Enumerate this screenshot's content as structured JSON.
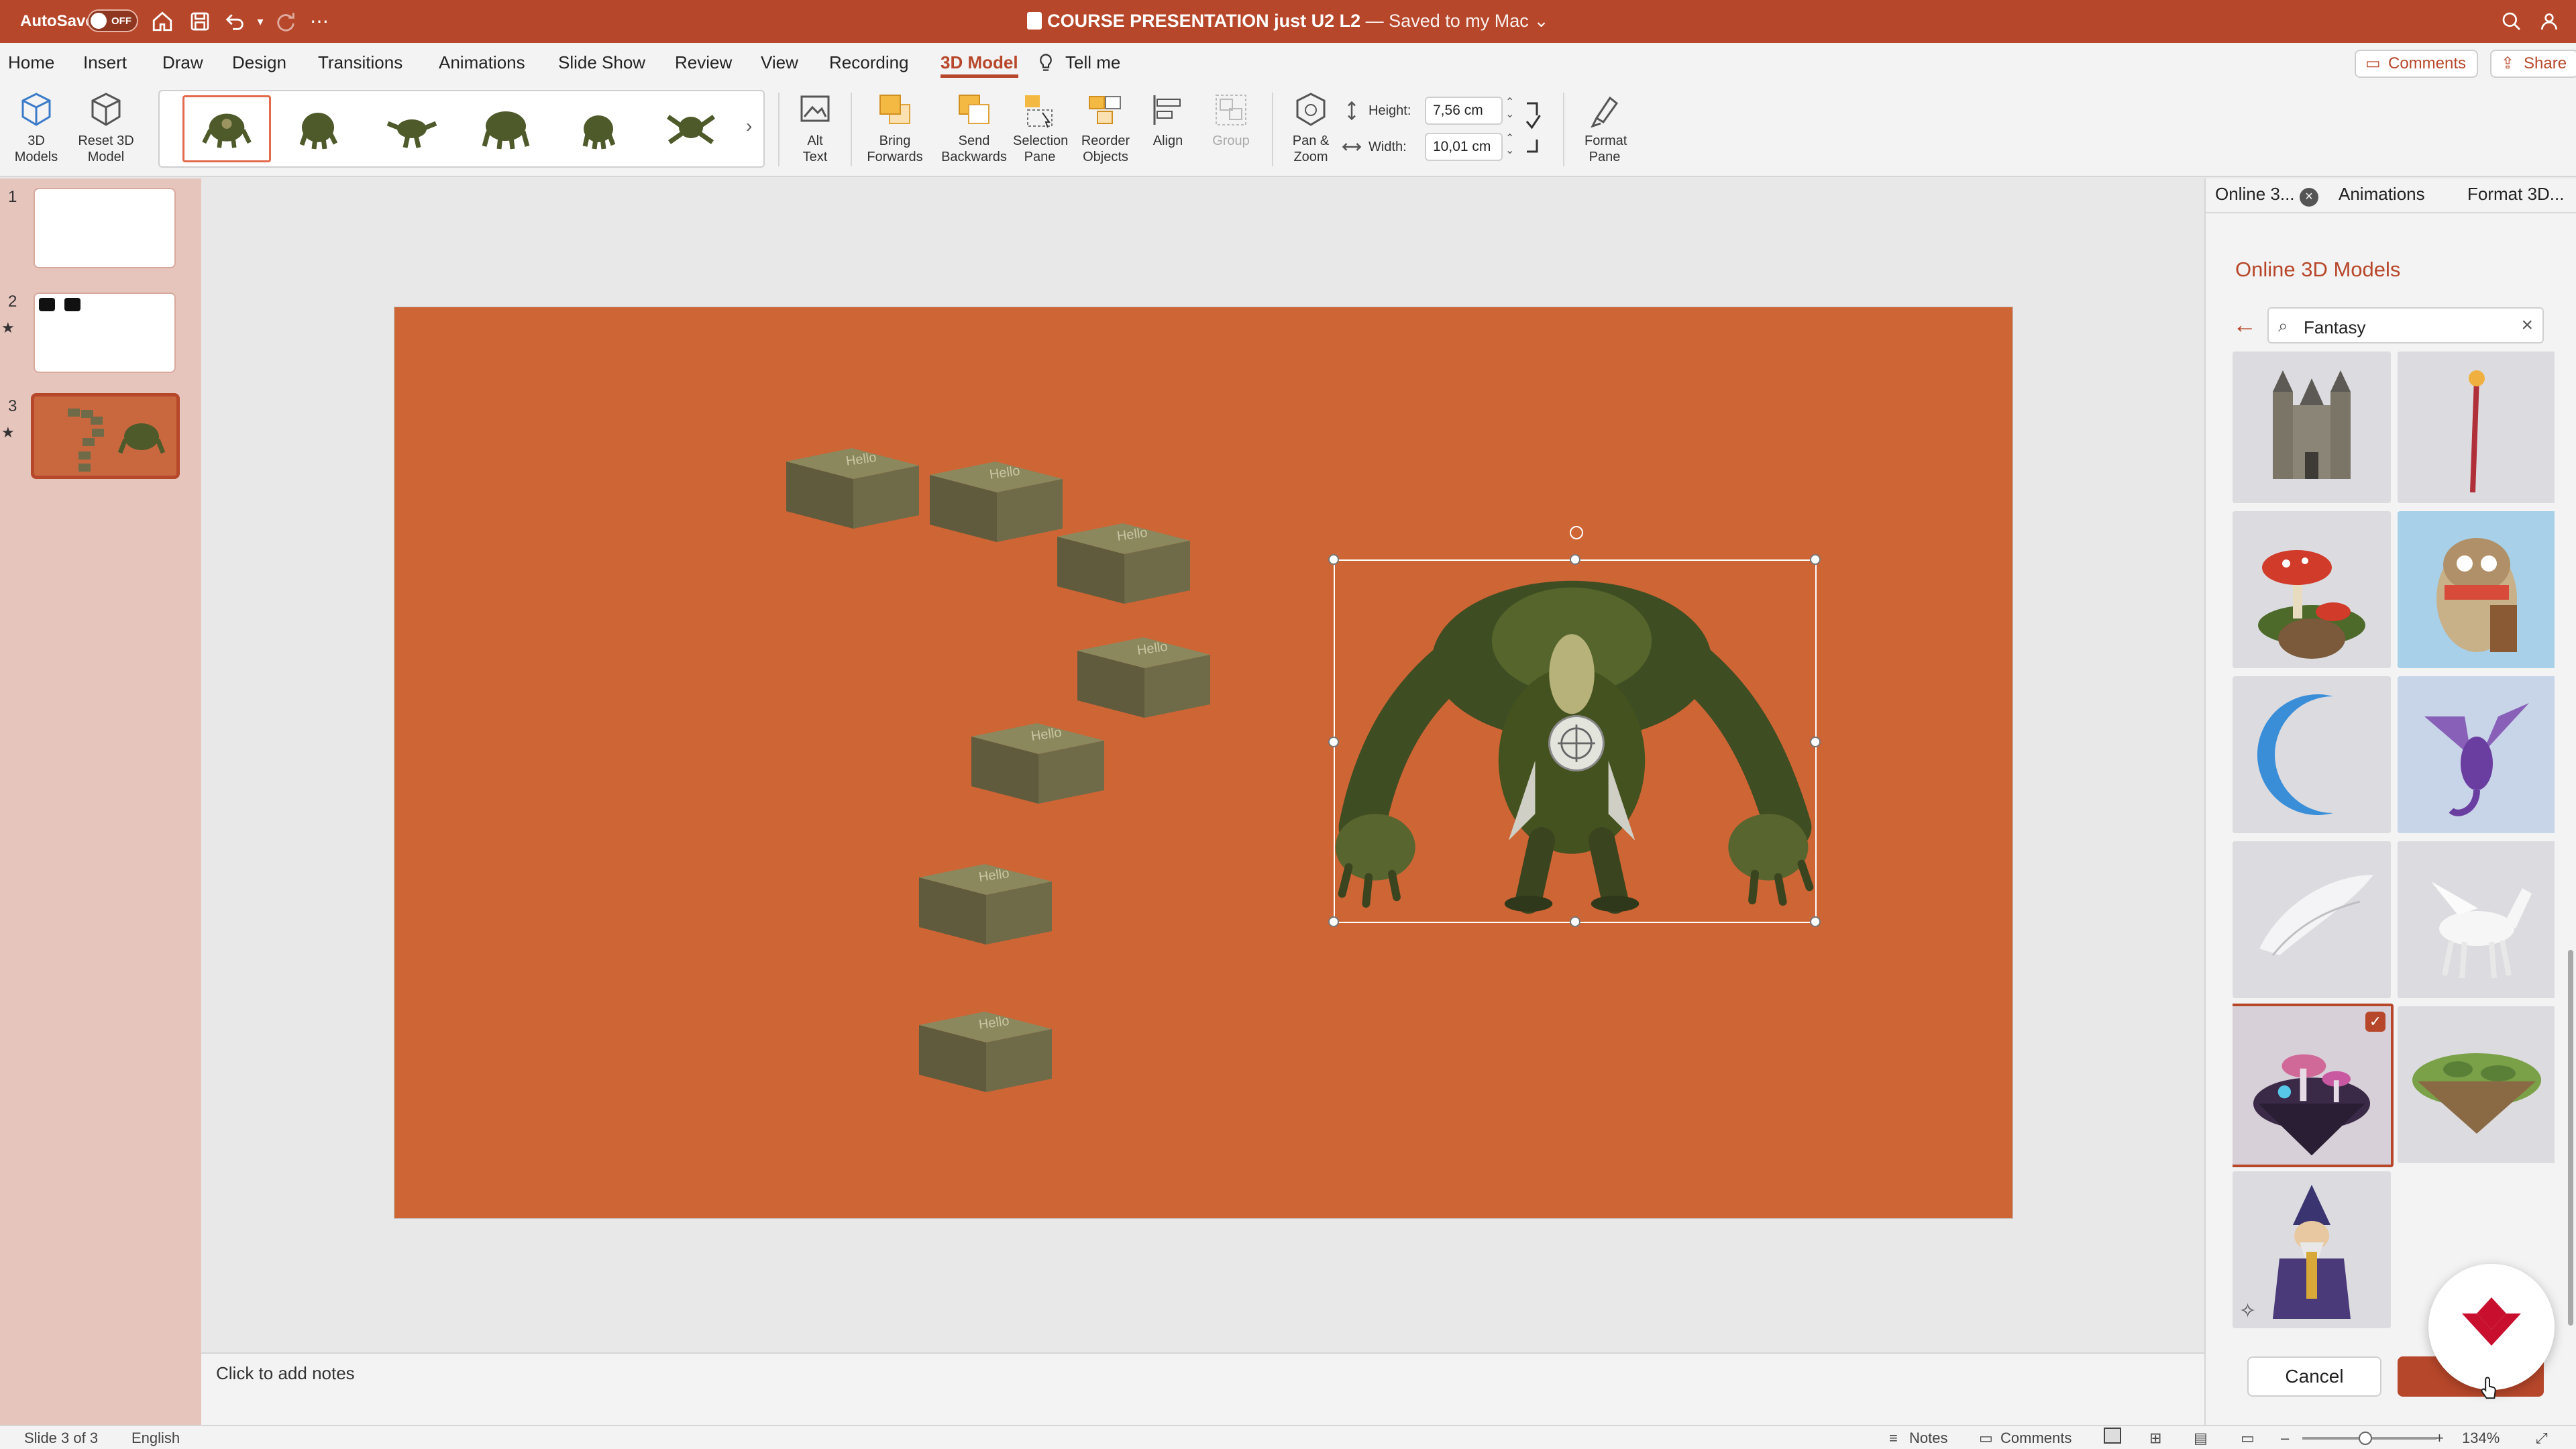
{
  "titlebar": {
    "autosave_label": "AutoSave",
    "autosave_state": "OFF",
    "doc_name": "COURSE PRESENTATION just U2 L2",
    "saved_status": "— Saved to my Mac",
    "dropdown_glyph": "⌄"
  },
  "tabs": [
    "Home",
    "Insert",
    "Draw",
    "Design",
    "Transitions",
    "Animations",
    "Slide Show",
    "Review",
    "View",
    "Recording",
    "3D Model",
    "Tell me"
  ],
  "active_tab": "3D Model",
  "header_buttons": {
    "comments": "Comments",
    "share": "Share"
  },
  "ribbon": {
    "models_label": "3D Models",
    "reset_label": "Reset 3D Model",
    "alt_text": "Alt Text",
    "bring_forwards": "Bring Forwards",
    "send_backwards": "Send Backwards",
    "selection_pane": "Selection Pane",
    "reorder_objects": "Reorder Objects",
    "align": "Align",
    "group": "Group",
    "pan_zoom": "Pan & Zoom",
    "height_label": "Height:",
    "height_value": "7,56 cm",
    "width_label": "Width:",
    "width_value": "10,01 cm",
    "format_pane": "Format Pane"
  },
  "thumbnails": [
    {
      "num": "1",
      "star": ""
    },
    {
      "num": "2",
      "star": "★"
    },
    {
      "num": "3",
      "star": "★"
    }
  ],
  "slide": {
    "box_label": "Hello"
  },
  "notes_placeholder": "Click to add notes",
  "right_pane": {
    "tabs": [
      "Online 3...",
      "Animations",
      "Format 3D..."
    ],
    "title": "Online 3D Models",
    "search_value": "Fantasy",
    "results": [
      "castle",
      "staff",
      "mushroom-island",
      "owl",
      "moon",
      "dragon",
      "wing",
      "pegasus",
      "fairy-island",
      "green-island",
      "wizard"
    ],
    "cancel_label": "Cancel"
  },
  "statusbar": {
    "slide_info": "Slide 3 of 3",
    "language": "English",
    "notes": "Notes",
    "comments": "Comments",
    "zoom": "134%"
  },
  "colors": {
    "accent": "#b7472a",
    "slide_bg": "#cd6535",
    "box_color": "#6f6b48"
  }
}
